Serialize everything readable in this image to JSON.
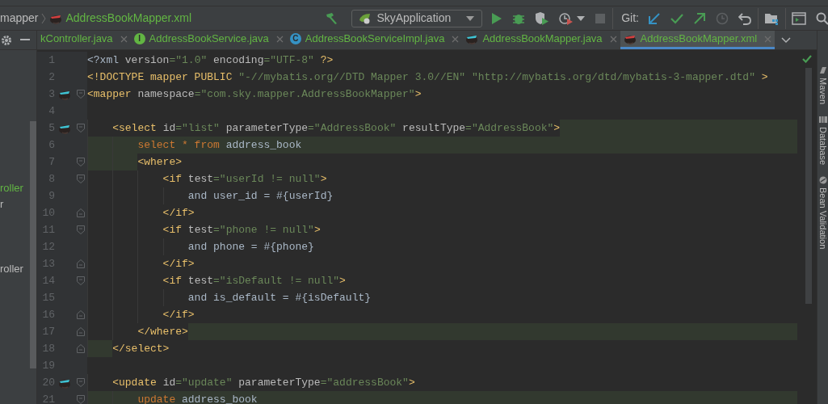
{
  "breadcrumb": [
    {
      "text": "mapper",
      "kind": "folder"
    },
    {
      "text": "AddressBookMapper.xml",
      "kind": "mapper"
    }
  ],
  "toolbar": [
    {
      "kind": "build",
      "disabled": false
    },
    {
      "kind": "run_config",
      "label": "SkyApplication",
      "disabled": false
    },
    {
      "kind": "run",
      "disabled": false
    },
    {
      "kind": "debug",
      "disabled": false
    },
    {
      "kind": "coverage",
      "disabled": false
    },
    {
      "kind": "profile",
      "disabled": false
    },
    {
      "kind": "stop",
      "disabled": true
    },
    {
      "kind": "git_label",
      "label": "Git:",
      "disabled": false
    },
    {
      "kind": "update",
      "disabled": false
    },
    {
      "kind": "commit",
      "disabled": false
    },
    {
      "kind": "push",
      "disabled": false
    },
    {
      "kind": "history",
      "disabled": true
    },
    {
      "kind": "rollback",
      "disabled": false
    },
    {
      "kind": "project_structure",
      "disabled": false
    },
    {
      "kind": "terminal",
      "disabled": false
    },
    {
      "kind": "search",
      "disabled": false
    }
  ],
  "project_panel": {
    "items": [
      {
        "text": "roller",
        "modified": true
      },
      {
        "text": "r",
        "modified": false
      },
      {
        "text": "roller",
        "modified": false
      }
    ]
  },
  "tabs": [
    {
      "label": "kController.java",
      "kind": "none",
      "selected": false
    },
    {
      "label": "AddressBookService.java",
      "kind": "interface",
      "icon_text": "I",
      "selected": false
    },
    {
      "label": "AddressBookServiceImpl.java",
      "kind": "class",
      "icon_text": "C",
      "selected": false
    },
    {
      "label": "AddressBookMapper.java",
      "kind": "mapper_java",
      "selected": false
    },
    {
      "label": "AddressBookMapper.xml",
      "kind": "mapper_xml",
      "selected": true
    }
  ],
  "editor": {
    "lines": [
      {
        "number": "1",
        "full_highlight": false,
        "leading_highlight": false,
        "trailing_highlight": false,
        "fold_open": false,
        "fold_close": false,
        "marker": false,
        "segments": [
          {
            "kind": "text",
            "t": "<?xml "
          },
          {
            "kind": "attr",
            "t": "version"
          },
          {
            "kind": "value",
            "t": "=\"1.0\""
          },
          {
            "kind": "attr",
            "t": " encoding"
          },
          {
            "kind": "value",
            "t": "=\"UTF-8\""
          },
          {
            "kind": "tag",
            "t": " ?>"
          }
        ]
      },
      {
        "number": "2",
        "full_highlight": false,
        "leading_highlight": false,
        "trailing_highlight": false,
        "fold_open": false,
        "fold_close": false,
        "marker": false,
        "segments": [
          {
            "kind": "tag",
            "t": "<!DOCTYPE mapper PUBLIC "
          },
          {
            "kind": "value",
            "t": "\"-//mybatis.org//DTD Mapper 3.0//EN\" \"http://mybatis.org/dtd/mybatis-3-mapper.dtd\""
          },
          {
            "kind": "tag",
            "t": " >"
          }
        ]
      },
      {
        "number": "3",
        "full_highlight": false,
        "leading_highlight": false,
        "trailing_highlight": false,
        "fold_open": true,
        "fold_close": false,
        "marker": true,
        "segments": [
          {
            "kind": "tag",
            "t": "<mapper"
          },
          {
            "kind": "attr",
            "t": " namespace"
          },
          {
            "kind": "value",
            "t": "=\"com.sky.mapper.AddressBookMapper\""
          },
          {
            "kind": "tag",
            "t": ">"
          }
        ]
      },
      {
        "number": "4",
        "full_highlight": false,
        "leading_highlight": false,
        "trailing_highlight": false,
        "fold_open": false,
        "fold_close": false,
        "marker": false
      },
      {
        "number": "5",
        "full_highlight": false,
        "leading_highlight": false,
        "trailing_highlight": true,
        "fold_open": true,
        "fold_close": false,
        "marker": true,
        "segments": [
          {
            "kind": "tag",
            "t": "    <select"
          },
          {
            "kind": "attr",
            "t": " id"
          },
          {
            "kind": "value",
            "t": "=\"list\""
          },
          {
            "kind": "attr",
            "t": " parameterType"
          },
          {
            "kind": "value",
            "t": "=\"AddressBook\""
          },
          {
            "kind": "attr",
            "t": " resultType"
          },
          {
            "kind": "value",
            "t": "=\"AddressBook\""
          },
          {
            "kind": "tag",
            "t": ">"
          }
        ]
      },
      {
        "number": "6",
        "full_highlight": true,
        "leading_highlight": false,
        "trailing_highlight": false,
        "fold_open": false,
        "fold_close": false,
        "marker": false,
        "segments": [
          {
            "kind": "sql",
            "t": "        select * from"
          },
          {
            "kind": "text",
            "t": " address_book"
          }
        ]
      },
      {
        "number": "7",
        "full_highlight": false,
        "leading_highlight": true,
        "trailing_highlight": false,
        "fold_open": true,
        "fold_close": false,
        "marker": false,
        "segments": [
          {
            "kind": "tag",
            "t": "        <where>"
          }
        ]
      },
      {
        "number": "8",
        "full_highlight": false,
        "leading_highlight": false,
        "trailing_highlight": false,
        "fold_open": true,
        "fold_close": false,
        "marker": false,
        "segments": [
          {
            "kind": "tag",
            "t": "            <if"
          },
          {
            "kind": "attr",
            "t": " test"
          },
          {
            "kind": "value",
            "t": "=\"userId != null\""
          },
          {
            "kind": "tag",
            "t": ">"
          }
        ]
      },
      {
        "number": "9",
        "full_highlight": false,
        "leading_highlight": false,
        "trailing_highlight": false,
        "fold_open": false,
        "fold_close": false,
        "marker": false,
        "segments": [
          {
            "kind": "text",
            "t": "                and user_id = #{userId}"
          }
        ]
      },
      {
        "number": "10",
        "full_highlight": false,
        "leading_highlight": false,
        "trailing_highlight": false,
        "fold_open": false,
        "fold_close": true,
        "marker": false,
        "segments": [
          {
            "kind": "tag",
            "t": "            </if>"
          }
        ]
      },
      {
        "number": "11",
        "full_highlight": false,
        "leading_highlight": false,
        "trailing_highlight": false,
        "fold_open": true,
        "fold_close": false,
        "marker": false,
        "segments": [
          {
            "kind": "tag",
            "t": "            <if"
          },
          {
            "kind": "attr",
            "t": " test"
          },
          {
            "kind": "value",
            "t": "=\"phone != null\""
          },
          {
            "kind": "tag",
            "t": ">"
          }
        ]
      },
      {
        "number": "12",
        "full_highlight": false,
        "leading_highlight": false,
        "trailing_highlight": false,
        "fold_open": false,
        "fold_close": false,
        "marker": false,
        "segments": [
          {
            "kind": "text",
            "t": "                and phone = #{phone}"
          }
        ]
      },
      {
        "number": "13",
        "full_highlight": false,
        "leading_highlight": false,
        "trailing_highlight": false,
        "fold_open": false,
        "fold_close": true,
        "marker": false,
        "segments": [
          {
            "kind": "tag",
            "t": "            </if>"
          }
        ]
      },
      {
        "number": "14",
        "full_highlight": false,
        "leading_highlight": false,
        "trailing_highlight": false,
        "fold_open": true,
        "fold_close": false,
        "marker": false,
        "segments": [
          {
            "kind": "tag",
            "t": "            <if"
          },
          {
            "kind": "attr",
            "t": " test"
          },
          {
            "kind": "value",
            "t": "=\"isDefault != null\""
          },
          {
            "kind": "tag",
            "t": ">"
          }
        ]
      },
      {
        "number": "15",
        "full_highlight": false,
        "leading_highlight": false,
        "trailing_highlight": false,
        "fold_open": false,
        "fold_close": false,
        "marker": false,
        "segments": [
          {
            "kind": "text",
            "t": "                and is_default = #{isDefault}"
          }
        ]
      },
      {
        "number": "16",
        "full_highlight": false,
        "leading_highlight": false,
        "trailing_highlight": false,
        "fold_open": false,
        "fold_close": true,
        "marker": false,
        "segments": [
          {
            "kind": "tag",
            "t": "            </if>"
          }
        ]
      },
      {
        "number": "17",
        "full_highlight": false,
        "leading_highlight": false,
        "trailing_highlight": true,
        "fold_open": false,
        "fold_close": true,
        "marker": false,
        "segments": [
          {
            "kind": "tag",
            "t": "        </where>"
          }
        ]
      },
      {
        "number": "18",
        "full_highlight": false,
        "leading_highlight": true,
        "trailing_highlight": false,
        "fold_open": false,
        "fold_close": true,
        "marker": false,
        "segments": [
          {
            "kind": "tag",
            "t": "    </select>"
          }
        ]
      },
      {
        "number": "19",
        "full_highlight": false,
        "leading_highlight": false,
        "trailing_highlight": false,
        "fold_open": false,
        "fold_close": false,
        "marker": false
      },
      {
        "number": "20",
        "full_highlight": false,
        "leading_highlight": false,
        "trailing_highlight": false,
        "fold_open": true,
        "fold_close": false,
        "marker": true,
        "segments": [
          {
            "kind": "tag",
            "t": "    <update"
          },
          {
            "kind": "attr",
            "t": " id"
          },
          {
            "kind": "value",
            "t": "=\"update\""
          },
          {
            "kind": "attr",
            "t": " parameterType"
          },
          {
            "kind": "value",
            "t": "=\"addressBook\""
          },
          {
            "kind": "tag",
            "t": ">"
          }
        ]
      },
      {
        "number": "21",
        "full_highlight": true,
        "leading_highlight": false,
        "trailing_highlight": false,
        "fold_open": true,
        "fold_close": false,
        "marker": false,
        "segments": [
          {
            "kind": "sql",
            "t": "        update"
          },
          {
            "kind": "text",
            "t": " address_book"
          }
        ]
      }
    ]
  },
  "side_tools": [
    {
      "label": "Maven",
      "kind": "maven"
    },
    {
      "label": "Database",
      "kind": "database"
    },
    {
      "label": "Bean Validation",
      "kind": "bean"
    }
  ]
}
